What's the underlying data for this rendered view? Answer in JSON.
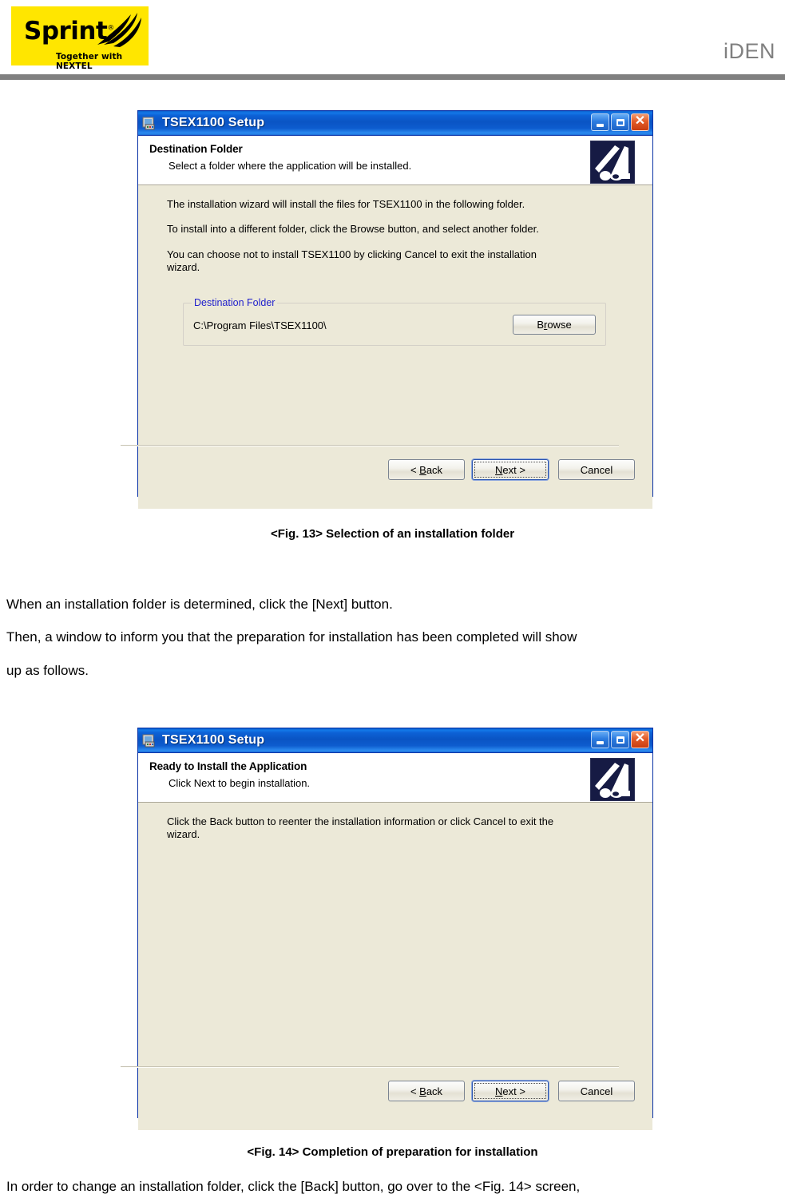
{
  "header": {
    "logo_wordmark": "Sprint",
    "logo_tagline": "Together with NEXTEL",
    "brand": "iDEN"
  },
  "figures": [
    {
      "id": "fig13",
      "window": {
        "title": "TSEX1100 Setup",
        "title_icon": "installer-package-icon",
        "buttons": {
          "minimize": "minimize-icon",
          "maximize": "maximize-icon",
          "close": "close-icon"
        }
      },
      "header": {
        "title": "Destination Folder",
        "subtitle": "Select a folder where the application will be installed."
      },
      "paragraphs": [
        "The installation wizard will install the files for TSEX1100 in the following folder.",
        "To install into a different folder, click the Browse button, and select another folder.",
        "You can choose not to install TSEX1100 by clicking Cancel to exit the installation wizard."
      ],
      "groupbox": {
        "label": "Destination Folder",
        "path_value": "C:\\Program Files\\TSEX1100\\",
        "browse_label_pre": "B",
        "browse_label_accel": "r",
        "browse_label_post": "owse"
      },
      "footer_buttons": [
        {
          "name": "back",
          "pre": "< ",
          "accel": "B",
          "post": "ack",
          "focused": false
        },
        {
          "name": "next",
          "pre": "",
          "accel": "N",
          "post": "ext >",
          "focused": true
        },
        {
          "name": "cancel",
          "pre": "",
          "accel": "",
          "post": "Cancel",
          "focused": false
        }
      ],
      "caption": "<Fig. 13> Selection of an installation folder"
    },
    {
      "id": "fig14",
      "window": {
        "title": "TSEX1100 Setup",
        "title_icon": "installer-package-icon",
        "buttons": {
          "minimize": "minimize-icon",
          "maximize": "maximize-icon",
          "close": "close-icon"
        }
      },
      "header": {
        "title": "Ready to Install the Application",
        "subtitle": "Click Next to begin installation."
      },
      "paragraphs": [
        "Click the Back button to reenter the installation information or click Cancel to exit the wizard."
      ],
      "footer_buttons": [
        {
          "name": "back",
          "pre": "< ",
          "accel": "B",
          "post": "ack",
          "focused": false
        },
        {
          "name": "next",
          "pre": "",
          "accel": "N",
          "post": "ext >",
          "focused": true
        },
        {
          "name": "cancel",
          "pre": "",
          "accel": "",
          "post": "Cancel",
          "focused": false
        }
      ],
      "caption": "<Fig. 14> Completion of preparation for installation"
    }
  ],
  "body_text": {
    "line1": "When an installation folder is determined, click the [Next] button.",
    "line2": "Then, a window to inform you that the preparation for installation has been completed will show",
    "line3": "up as follows.",
    "line4": "In order to change an installation folder, click the [Back] button, go over to the <Fig. 14> screen,"
  },
  "colors": {
    "logo_yellow": "#FFE600",
    "brand_gray": "#808080",
    "titlebar_blue": "#0A54C4",
    "dialog_face": "#ECE9D8",
    "group_label_blue": "#2222CC"
  }
}
